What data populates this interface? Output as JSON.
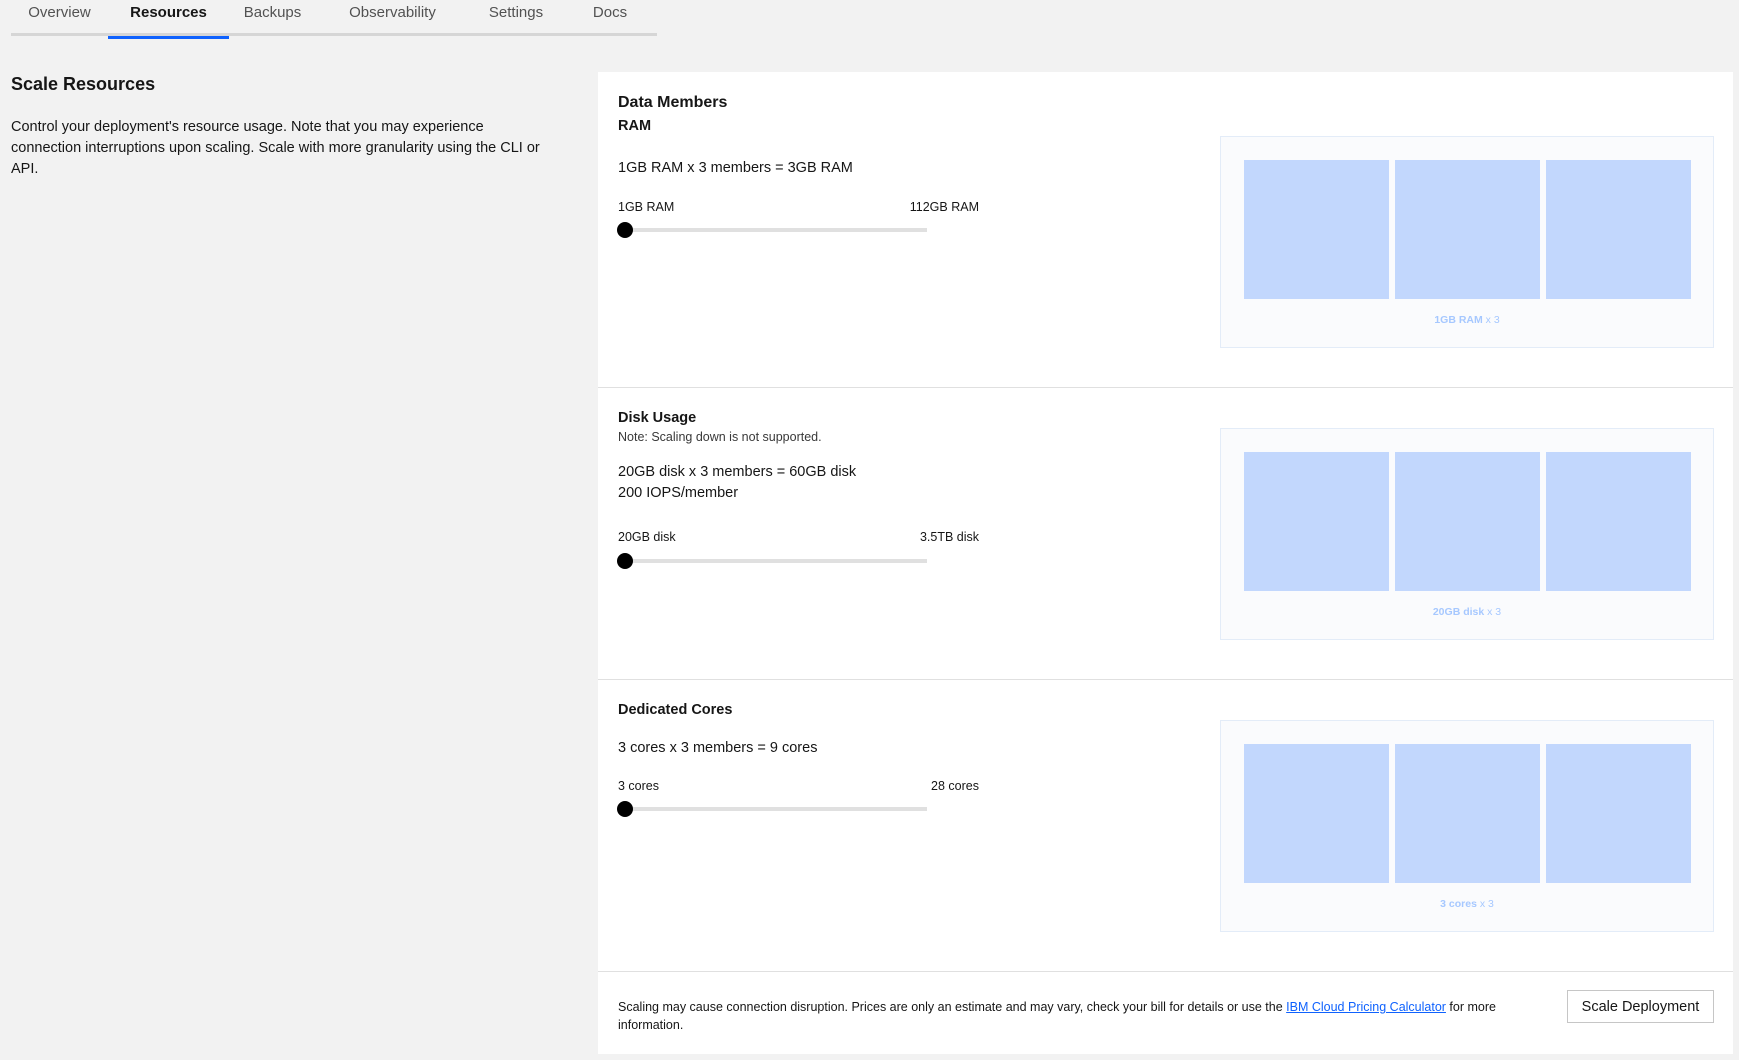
{
  "tabs": [
    {
      "label": "Overview"
    },
    {
      "label": "Resources"
    },
    {
      "label": "Backups"
    },
    {
      "label": "Observability"
    },
    {
      "label": "Settings"
    },
    {
      "label": "Docs"
    }
  ],
  "active_tab": "Resources",
  "intro": {
    "title": "Scale Resources",
    "description": "Control your deployment's resource usage. Note that you may experience connection interruptions upon scaling. Scale with more granularity using the CLI or API."
  },
  "data_members": {
    "title": "Data Members",
    "subtitle": "RAM",
    "calculation": "1GB RAM x 3 members = 3GB RAM",
    "range_min": "1GB RAM",
    "range_max": "112GB RAM",
    "slider_level": 0,
    "viz_value": "1GB RAM",
    "viz_multiplier": "x 3"
  },
  "disk": {
    "title": "Disk Usage",
    "note": "Note: Scaling down is not supported.",
    "calculation": "20GB disk x 3 members = 60GB disk",
    "iops": "200 IOPS/member",
    "range_min": "20GB disk",
    "range_max": "3.5TB disk",
    "slider_level": 0,
    "viz_value": "20GB disk",
    "viz_multiplier": "x 3"
  },
  "cores": {
    "title": "Dedicated Cores",
    "calculation": "3 cores x 3 members = 9 cores",
    "range_min": "3 cores",
    "range_max": "28 cores",
    "slider_level": 0,
    "viz_value": "3 cores",
    "viz_multiplier": "x 3"
  },
  "footer": {
    "text_before": "Scaling may cause connection disruption. Prices are only an estimate and may vary, check your bill for details or use the ",
    "link": "IBM Cloud Pricing Calculator",
    "text_after": " for more information.",
    "button": "Scale Deployment"
  },
  "colors": {
    "accent": "#0f62fe",
    "member_block": "#c2d7fd",
    "viz_label": "#a6c8ff",
    "slider_thumb": "#000000"
  }
}
